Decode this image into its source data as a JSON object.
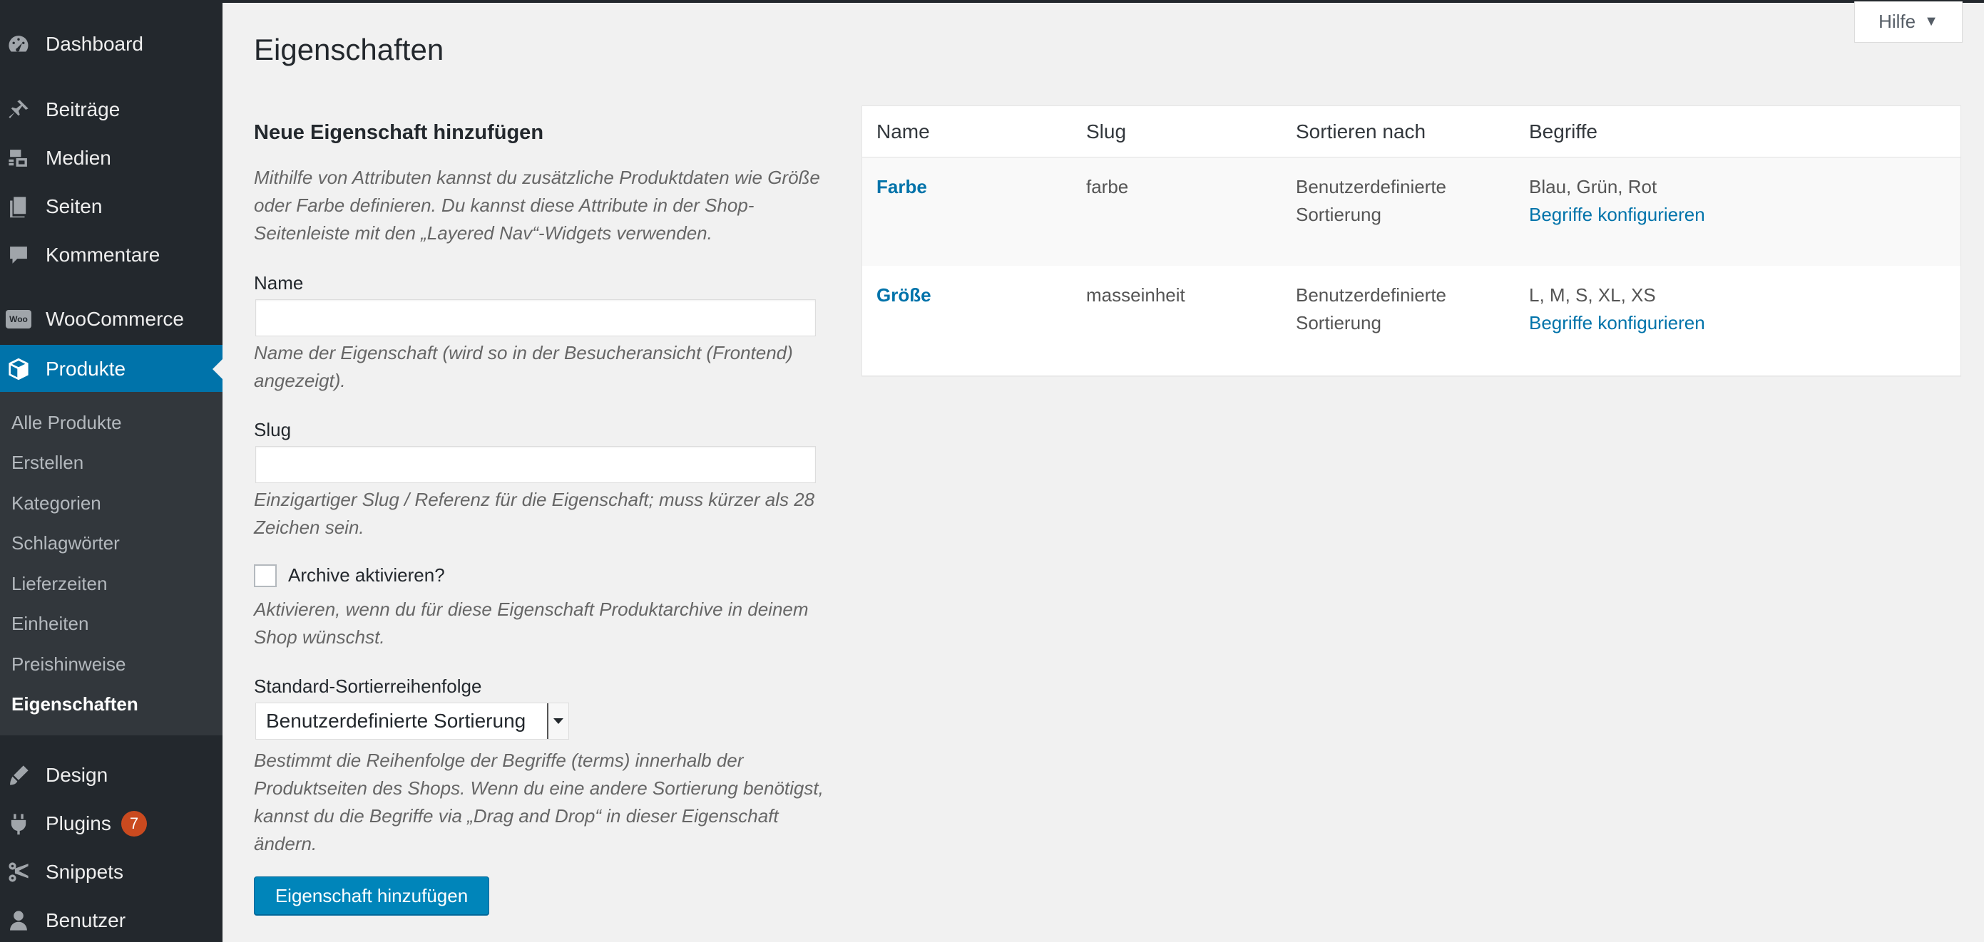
{
  "sidebar": {
    "items": [
      {
        "label": "Dashboard",
        "icon": "dashboard-icon"
      },
      {
        "label": "Beiträge",
        "icon": "pin-icon"
      },
      {
        "label": "Medien",
        "icon": "media-icon"
      },
      {
        "label": "Seiten",
        "icon": "pages-icon"
      },
      {
        "label": "Kommentare",
        "icon": "comments-icon"
      },
      {
        "label": "WooCommerce",
        "icon": "woocommerce-icon"
      },
      {
        "label": "Produkte",
        "icon": "products-icon"
      },
      {
        "label": "Design",
        "icon": "appearance-icon"
      },
      {
        "label": "Plugins",
        "icon": "plugins-icon",
        "badge": "7"
      },
      {
        "label": "Snippets",
        "icon": "scissors-icon"
      },
      {
        "label": "Benutzer",
        "icon": "users-icon"
      }
    ],
    "woo_icon_text": "Woo",
    "submenu": [
      "Alle Produkte",
      "Erstellen",
      "Kategorien",
      "Schlagwörter",
      "Lieferzeiten",
      "Einheiten",
      "Preishinweise",
      "Eigenschaften"
    ]
  },
  "header": {
    "title": "Eigenschaften",
    "help_label": "Hilfe",
    "help_arrow": "▼"
  },
  "form": {
    "heading": "Neue Eigenschaft hinzufügen",
    "intro": "Mithilfe von Attributen kannst du zusätzliche Produktdaten wie Größe oder Farbe definieren. Du kannst diese Attribute in der Shop-Seitenleiste mit den „Layered Nav“-Widgets verwenden.",
    "name_label": "Name",
    "name_value": "",
    "name_desc": "Name der Eigenschaft (wird so in der Besucheransicht (Frontend) angezeigt).",
    "slug_label": "Slug",
    "slug_value": "",
    "slug_desc": "Einzigartiger Slug / Referenz für die Eigenschaft; muss kürzer als 28 Zeichen sein.",
    "archive_label": "Archive aktivieren?",
    "archive_desc": "Aktivieren, wenn du für diese Eigenschaft Produktarchive in deinem Shop wünschst.",
    "sort_label": "Standard-Sortierreihenfolge",
    "sort_value": "Benutzerdefinierte Sortierung",
    "sort_desc": "Bestimmt die Reihenfolge der Begriffe (terms) innerhalb der Produktseiten des Shops. Wenn du eine andere Sortierung benötigst, kannst du die Begriffe via „Drag and Drop“ in dieser Eigenschaft ändern.",
    "submit_label": "Eigenschaft hinzufügen"
  },
  "table": {
    "columns": [
      "Name",
      "Slug",
      "Sortieren nach",
      "Begriffe"
    ],
    "rows": [
      {
        "name": "Farbe",
        "slug": "farbe",
        "sort": "Benutzerdefinierte Sortierung",
        "terms": "Blau, Grün, Rot",
        "configure": "Begriffe konfigurieren"
      },
      {
        "name": "Größe",
        "slug": "masseinheit",
        "sort": "Benutzerdefinierte Sortierung",
        "terms": "L, M, S, XL, XS",
        "configure": "Begriffe konfigurieren"
      }
    ]
  },
  "colors": {
    "sidebar_bg": "#23282d",
    "submenu_bg": "#32373c",
    "accent": "#0073aa",
    "button": "#0085ba",
    "badge": "#ca4a1f"
  }
}
